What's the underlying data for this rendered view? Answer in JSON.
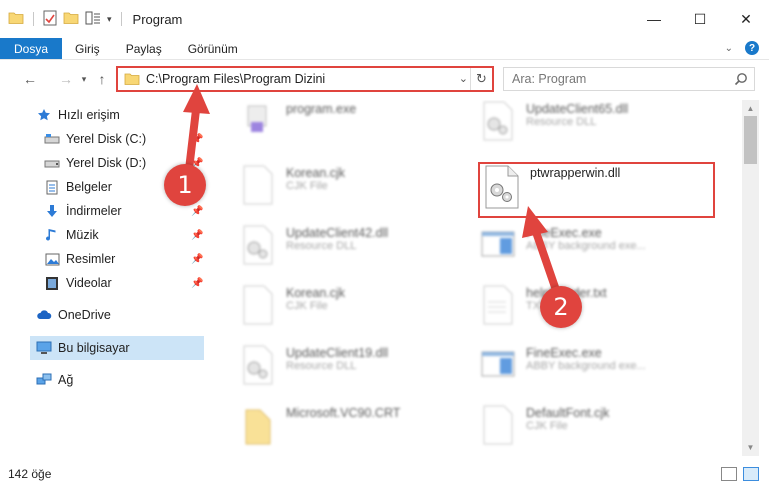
{
  "window": {
    "title": "Program",
    "minimize_label": "—",
    "maximize_label": "☐",
    "close_label": "✕"
  },
  "ribbon": {
    "tabs": [
      "Dosya",
      "Giriş",
      "Paylaş",
      "Görünüm"
    ],
    "active_tab": "Dosya"
  },
  "address": {
    "path": "C:\\Program Files\\Program Dizini",
    "search_placeholder": "Ara: Program"
  },
  "sidebar": {
    "items": [
      {
        "label": "Hızlı erişim",
        "icon": "star-icon",
        "pinned": false
      },
      {
        "label": "Yerel Disk (C:)",
        "icon": "drive-icon",
        "pinned": true
      },
      {
        "label": "Yerel Disk (D:)",
        "icon": "drive-icon",
        "pinned": true
      },
      {
        "label": "Belgeler",
        "icon": "document-icon",
        "pinned": true
      },
      {
        "label": "İndirmeler",
        "icon": "download-icon",
        "pinned": true
      },
      {
        "label": "Müzik",
        "icon": "music-icon",
        "pinned": true
      },
      {
        "label": "Resimler",
        "icon": "pictures-icon",
        "pinned": true
      },
      {
        "label": "Videolar",
        "icon": "video-icon",
        "pinned": true
      },
      {
        "label": "OneDrive",
        "icon": "cloud-icon",
        "pinned": false
      },
      {
        "label": "Bu bilgisayar",
        "icon": "computer-icon",
        "pinned": false,
        "selected": true
      },
      {
        "label": "Ağ",
        "icon": "network-icon",
        "pinned": false
      }
    ]
  },
  "files": [
    {
      "name": "program.exe",
      "type": "",
      "icon": "exe-icon"
    },
    {
      "name": "UpdateClient65.dll",
      "type": "Resource DLL",
      "icon": "dll-icon"
    },
    {
      "name": "Korean.cjk",
      "type": "CJK File",
      "icon": "blank-file-icon"
    },
    {
      "name": "ptwrapperwin.dll",
      "type": "",
      "icon": "dll-icon",
      "highlighted": true
    },
    {
      "name": "UpdateClient42.dll",
      "type": "Resource DLL",
      "icon": "dll-icon"
    },
    {
      "name": "FineExec.exe",
      "type": "ABBY background exe...",
      "icon": "window-exe-icon"
    },
    {
      "name": "Korean.cjk",
      "type": "CJK File",
      "icon": "blank-file-icon"
    },
    {
      "name": "helpReader.txt",
      "type": "TXT",
      "icon": "text-file-icon"
    },
    {
      "name": "UpdateClient19.dll",
      "type": "Resource DLL",
      "icon": "dll-icon"
    },
    {
      "name": "FineExec.exe",
      "type": "ABBY background exe...",
      "icon": "window-exe-icon"
    },
    {
      "name": "Microsoft.VC90.CRT",
      "type": "",
      "icon": "folder-icon"
    },
    {
      "name": "DefaultFont.cjk",
      "type": "CJK File",
      "icon": "blank-file-icon"
    }
  ],
  "status": {
    "item_count": "142 öğe"
  },
  "annotations": {
    "step1": "1",
    "step2": "2",
    "color": "#e0443e"
  },
  "colors": {
    "accent": "#1979ca",
    "selection": "#cce4f7"
  }
}
